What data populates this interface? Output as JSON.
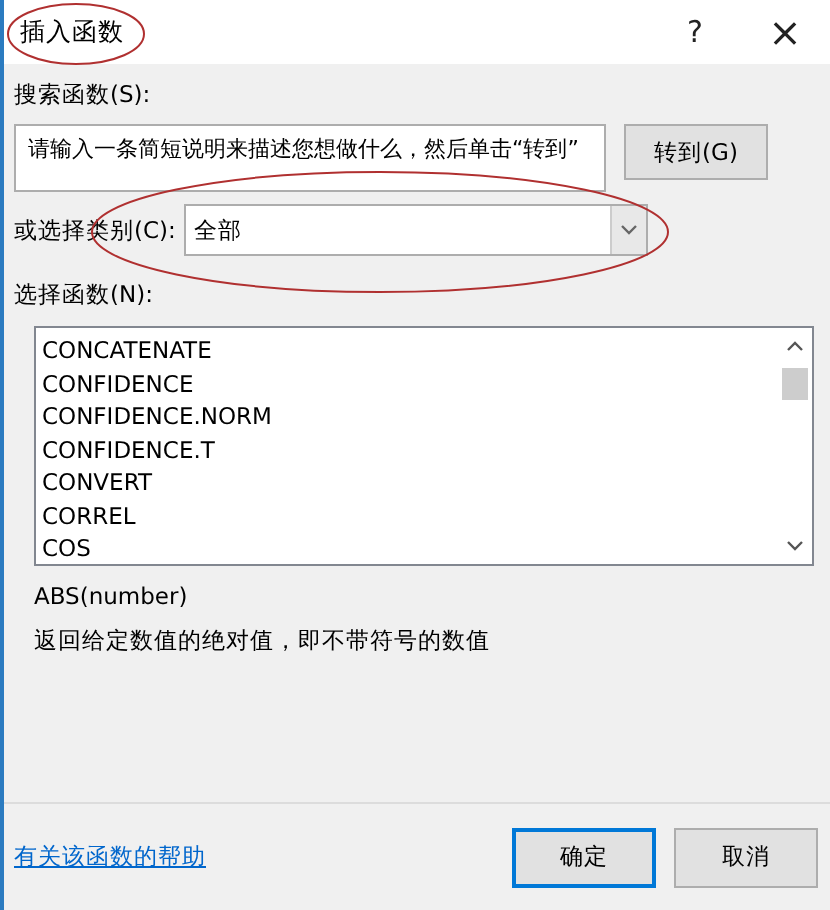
{
  "window": {
    "title": "插入函数",
    "help": "?",
    "close": "×"
  },
  "search": {
    "label": "搜索函数(S):",
    "value": "请输入一条简短说明来描述您想做什么，然后单击“转到”",
    "button": "转到(G)"
  },
  "category": {
    "label": "或选择类别(C):",
    "value": "全部"
  },
  "functions": {
    "label": "选择函数(N):",
    "items": [
      {
        "name": "CONCATENATE",
        "selected": false
      },
      {
        "name": "CONFIDENCE",
        "selected": false
      },
      {
        "name": "CONFIDENCE.NORM",
        "selected": false
      },
      {
        "name": "CONFIDENCE.T",
        "selected": false
      },
      {
        "name": "CONVERT",
        "selected": false
      },
      {
        "name": "CORREL",
        "selected": false
      },
      {
        "name": "COS",
        "selected": false
      }
    ]
  },
  "signature": "ABS(number)",
  "description": "返回给定数值的绝对值，即不带符号的数值",
  "help_link": "有关该函数的帮助",
  "buttons": [
    "确定",
    "取消"
  ]
}
